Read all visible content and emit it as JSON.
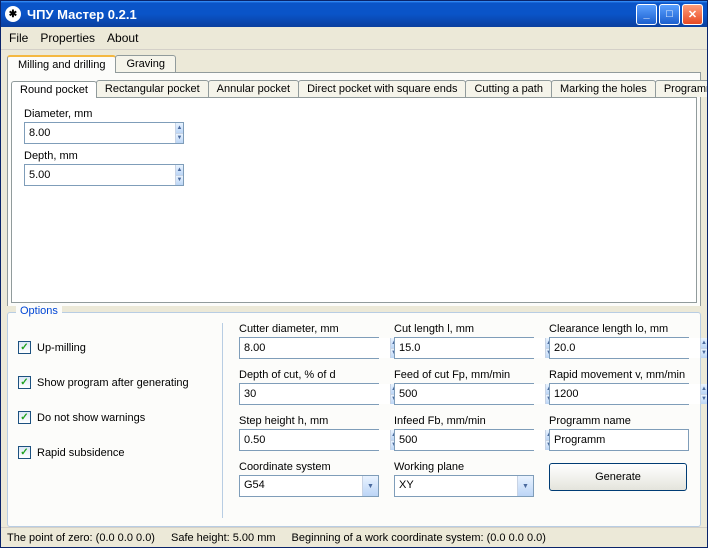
{
  "window": {
    "title": "ЧПУ Мастер 0.2.1"
  },
  "menu": {
    "file": "File",
    "properties": "Properties",
    "about": "About"
  },
  "outer_tabs": {
    "milling": "Milling and drilling",
    "graving": "Graving"
  },
  "inner_tabs": {
    "round": "Round pocket",
    "rect": "Rectangular pocket",
    "annular": "Annular pocket",
    "direct": "Direct pocket with square ends",
    "cutting": "Cutting a path",
    "marking": "Marking the holes",
    "programm": "Programm"
  },
  "pocket": {
    "diameter_label": "Diameter, mm",
    "diameter_value": "8.00",
    "depth_label": "Depth, mm",
    "depth_value": "5.00"
  },
  "options": {
    "legend": "Options",
    "up_milling": "Up-milling",
    "show_program": "Show program after generating",
    "no_warnings": "Do not show warnings",
    "rapid_subsidence": "Rapid subsidence"
  },
  "params": {
    "cutter_diameter": {
      "label": "Cutter diameter, mm",
      "value": "8.00"
    },
    "cut_length": {
      "label": "Cut length l, mm",
      "value": "15.0"
    },
    "clearance_length": {
      "label": "Clearance length lo, mm",
      "value": "20.0"
    },
    "depth_of_cut": {
      "label": "Depth of cut, % of d",
      "value": "30"
    },
    "feed_of_cut": {
      "label": "Feed of cut Fp, mm/min",
      "value": "500"
    },
    "rapid_movement": {
      "label": "Rapid movement v, mm/min",
      "value": "1200"
    },
    "step_height": {
      "label": "Step height h, mm",
      "value": "0.50"
    },
    "infeed": {
      "label": "Infeed Fb, mm/min",
      "value": "500"
    },
    "program_name": {
      "label": "Programm name",
      "value": "Programm"
    },
    "coord_system": {
      "label": "Coordinate system",
      "value": "G54"
    },
    "working_plane": {
      "label": "Working plane",
      "value": "XY"
    }
  },
  "buttons": {
    "generate": "Generate"
  },
  "status": {
    "zero": "The point of zero: (0.0  0.0  0.0)",
    "safe": "Safe height: 5.00 mm",
    "begin": "Beginning of a work coordinate system: (0.0  0.0  0.0)"
  }
}
